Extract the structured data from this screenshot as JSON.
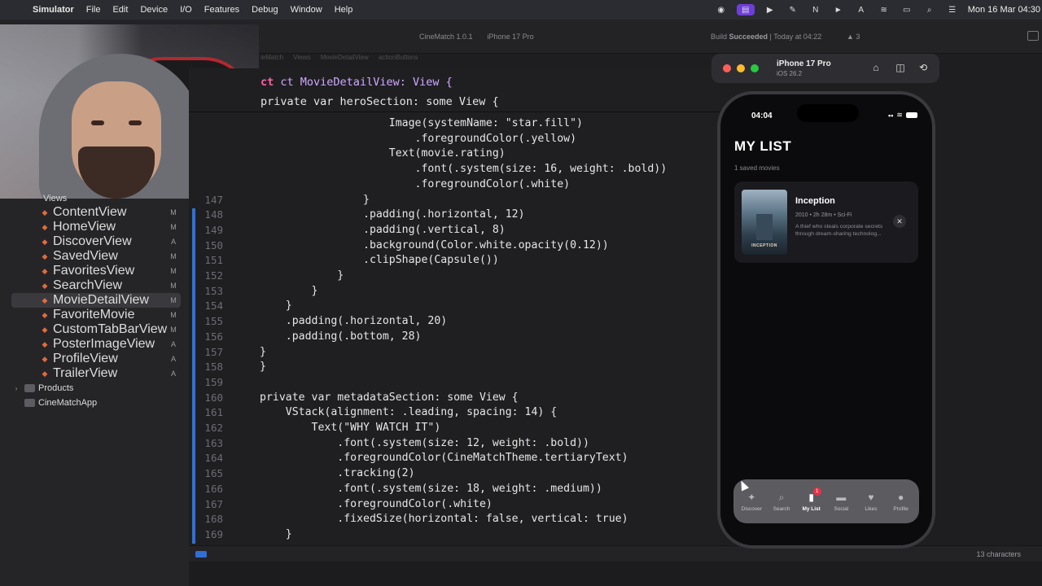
{
  "menubar": {
    "app": "Simulator",
    "items": [
      "File",
      "Edit",
      "Device",
      "I/O",
      "Features",
      "Debug",
      "Window",
      "Help"
    ],
    "clock": "Mon 16 Mar  04:30"
  },
  "toolbar": {
    "project": "CineMatch 1.0.1",
    "device": "iPhone 17 Pro",
    "status_prefix": "Build ",
    "status_result": "Succeeded",
    "status_time": " | Today at 04:22",
    "warnings": "3"
  },
  "jumpbar": [
    "ieMatch",
    "Views",
    "MovieDetailView",
    "actionButtons"
  ],
  "navigator": {
    "group": "Views",
    "files": [
      {
        "name": "ContentView",
        "badge": "M"
      },
      {
        "name": "HomeView",
        "badge": "M"
      },
      {
        "name": "DiscoverView",
        "badge": "A"
      },
      {
        "name": "SavedView",
        "badge": "M"
      },
      {
        "name": "FavoritesView",
        "badge": "M"
      },
      {
        "name": "SearchView",
        "badge": "M"
      },
      {
        "name": "MovieDetailView",
        "badge": "M"
      },
      {
        "name": "FavoriteMovie",
        "badge": "M"
      },
      {
        "name": "CustomTabBarView",
        "badge": "M"
      },
      {
        "name": "PosterImageView",
        "badge": "A"
      },
      {
        "name": "ProfileView",
        "badge": "A"
      },
      {
        "name": "TrailerView",
        "badge": "A"
      }
    ],
    "products": "Products",
    "app": "CineMatchApp"
  },
  "editor": {
    "sticky1": "ct MovieDetailView: View {",
    "sticky2": "private var heroSection: some View {",
    "lines": [
      {
        "n": "",
        "code": "                    Image(systemName: \"star.fill\")"
      },
      {
        "n": "",
        "code": "                        .foregroundColor(.yellow)"
      },
      {
        "n": "",
        "code": "                    Text(movie.rating)"
      },
      {
        "n": "",
        "code": "                        .font(.system(size: 16, weight: .bold))"
      },
      {
        "n": "",
        "code": "                        .foregroundColor(.white)"
      },
      {
        "n": "147",
        "code": "                }"
      },
      {
        "n": "148",
        "code": "                .padding(.horizontal, 12)"
      },
      {
        "n": "149",
        "code": "                .padding(.vertical, 8)"
      },
      {
        "n": "150",
        "code": "                .background(Color.white.opacity(0.12))"
      },
      {
        "n": "151",
        "code": "                .clipShape(Capsule())"
      },
      {
        "n": "152",
        "code": "            }"
      },
      {
        "n": "153",
        "code": "        }"
      },
      {
        "n": "154",
        "code": "    }"
      },
      {
        "n": "155",
        "code": "    .padding(.horizontal, 20)"
      },
      {
        "n": "156",
        "code": "    .padding(.bottom, 28)"
      },
      {
        "n": "157",
        "code": "}"
      },
      {
        "n": "158",
        "code": "}"
      },
      {
        "n": "159",
        "code": ""
      },
      {
        "n": "160",
        "code": "private var metadataSection: some View {"
      },
      {
        "n": "161",
        "code": "    VStack(alignment: .leading, spacing: 14) {"
      },
      {
        "n": "162",
        "code": "        Text(\"WHY WATCH IT\")"
      },
      {
        "n": "163",
        "code": "            .font(.system(size: 12, weight: .bold))"
      },
      {
        "n": "164",
        "code": "            .foregroundColor(CineMatchTheme.tertiaryText)"
      },
      {
        "n": "165",
        "code": "            .tracking(2)"
      },
      {
        "n": "166",
        "code": "            .font(.system(size: 18, weight: .medium))"
      },
      {
        "n": "167",
        "code": "            .foregroundColor(.white)"
      },
      {
        "n": "168",
        "code": "            .fixedSize(horizontal: false, vertical: true)"
      },
      {
        "n": "169",
        "code": "    }"
      }
    ]
  },
  "bottombar": {
    "chars": "13 characters"
  },
  "simulator": {
    "device": "iPhone 17 Pro",
    "os": "iOS 26.2",
    "time": "04:04",
    "title": "MY LIST",
    "count": "1 saved movies",
    "movie": {
      "title": "Inception",
      "meta": "2010 • 2h 28m • Sci-Fi",
      "desc": "A thief who steals corporate secrets through dream-sharing technolog...",
      "poster_text": "INCEPTION"
    },
    "tabs": [
      {
        "label": "Discover",
        "icon": "sparkle-icon",
        "glyph": "✦"
      },
      {
        "label": "Search",
        "icon": "search-icon",
        "glyph": "⌕"
      },
      {
        "label": "My List",
        "icon": "bookmark-icon",
        "glyph": "▮",
        "badge": "1"
      },
      {
        "label": "Social",
        "icon": "chat-bubbles-icon",
        "glyph": "▬"
      },
      {
        "label": "Likes",
        "icon": "heart-icon",
        "glyph": "♥"
      },
      {
        "label": "Profile",
        "icon": "person-icon",
        "glyph": "●"
      }
    ]
  }
}
